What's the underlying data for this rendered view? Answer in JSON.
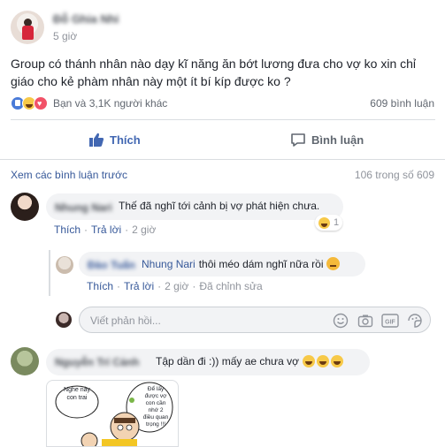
{
  "post": {
    "author": "Đỗ Ghia Nhi",
    "time": "5 giờ",
    "text_line1": "Group có thánh nhân nào dạy kĩ năng ăn bớt lương đưa cho vợ ko xin chỉ",
    "text_line2": "giáo cho kẻ phàm nhân này một ít bí kíp được ko ?",
    "reactions_text": "Bạn và 3,1K người khác",
    "comment_count": "609 bình luận",
    "like_label": "Thích",
    "comment_label": "Bình luận"
  },
  "comments_header": {
    "view_previous": "Xem các bình luận trước",
    "count": "106 trong số 609"
  },
  "comment1": {
    "name": "Nhung Nari",
    "text": "Thế đã nghĩ tới cảnh bị vợ phát hiện chưa.",
    "like": "Thích",
    "reply": "Trả lời",
    "time": "2 giờ",
    "reaction_count": "1"
  },
  "reply1": {
    "name": "Đào Tuấn",
    "mention": "Nhung Nari",
    "text": "thôi méo dám nghĩ nữa rồi",
    "like": "Thích",
    "reply": "Trả lời",
    "time": "2 giờ",
    "edited": "Đã chỉnh sửa"
  },
  "reply_input": {
    "placeholder": "Viết phản hồi..."
  },
  "comment2": {
    "name": "Nguyễn Trí Cảnh",
    "text": "Tập dần đi :)) mấy ae chưa vợ",
    "bubble_left": "Nghe này con trai",
    "bubble_right": "Để lấy được vợ con cần nhớ 2 điều quan trọng !!!"
  },
  "colors": {
    "facebook_blue": "#4267b2",
    "link": "#365899",
    "muted": "#90949c"
  }
}
